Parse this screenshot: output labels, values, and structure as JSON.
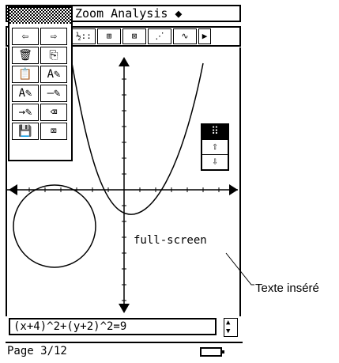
{
  "app": {
    "title": "Zoom Analysis ◆"
  },
  "toolbar": {
    "buttons": [
      {
        "icon": "split-table-icon",
        "label": "½::"
      },
      {
        "icon": "zoom-box-icon",
        "label": "⊞"
      },
      {
        "icon": "zoom-in-icon",
        "label": "⊠"
      },
      {
        "icon": "zoom-out-icon",
        "label": "⋰"
      },
      {
        "icon": "graph-xy-icon",
        "label": "∿"
      }
    ],
    "more_label": "▶"
  },
  "edit_menu": {
    "items": [
      {
        "name": "undo-icon",
        "glyph": "⇦"
      },
      {
        "name": "redo-icon",
        "glyph": "⇨"
      },
      {
        "name": "delete-icon",
        "glyph": "🗑"
      },
      {
        "name": "copy-icon",
        "glyph": "⎘"
      },
      {
        "name": "paste-icon",
        "glyph": "📋"
      },
      {
        "name": "text-edit-icon",
        "glyph": "A✎"
      },
      {
        "name": "format-text-icon",
        "glyph": "A✎"
      },
      {
        "name": "line-pen-icon",
        "glyph": "—✎"
      },
      {
        "name": "arrow-pen-icon",
        "glyph": "→✎"
      },
      {
        "name": "eraser-icon",
        "glyph": "⌫"
      },
      {
        "name": "save-icon",
        "glyph": "💾"
      },
      {
        "name": "clear-icon",
        "glyph": "⌧"
      }
    ]
  },
  "side_panel": {
    "buttons": [
      {
        "name": "panel-menu-icon",
        "glyph": "⠿"
      },
      {
        "name": "up-arrow-icon",
        "glyph": "⇧"
      },
      {
        "name": "down-arrow-icon",
        "glyph": "⇩"
      }
    ]
  },
  "graph": {
    "annotation": "full-screen"
  },
  "input": {
    "value": "(x+4)^2+(y+2)^2=9"
  },
  "status": {
    "page": "Page 3/12"
  },
  "callout": {
    "text": "Texte inséré"
  }
}
